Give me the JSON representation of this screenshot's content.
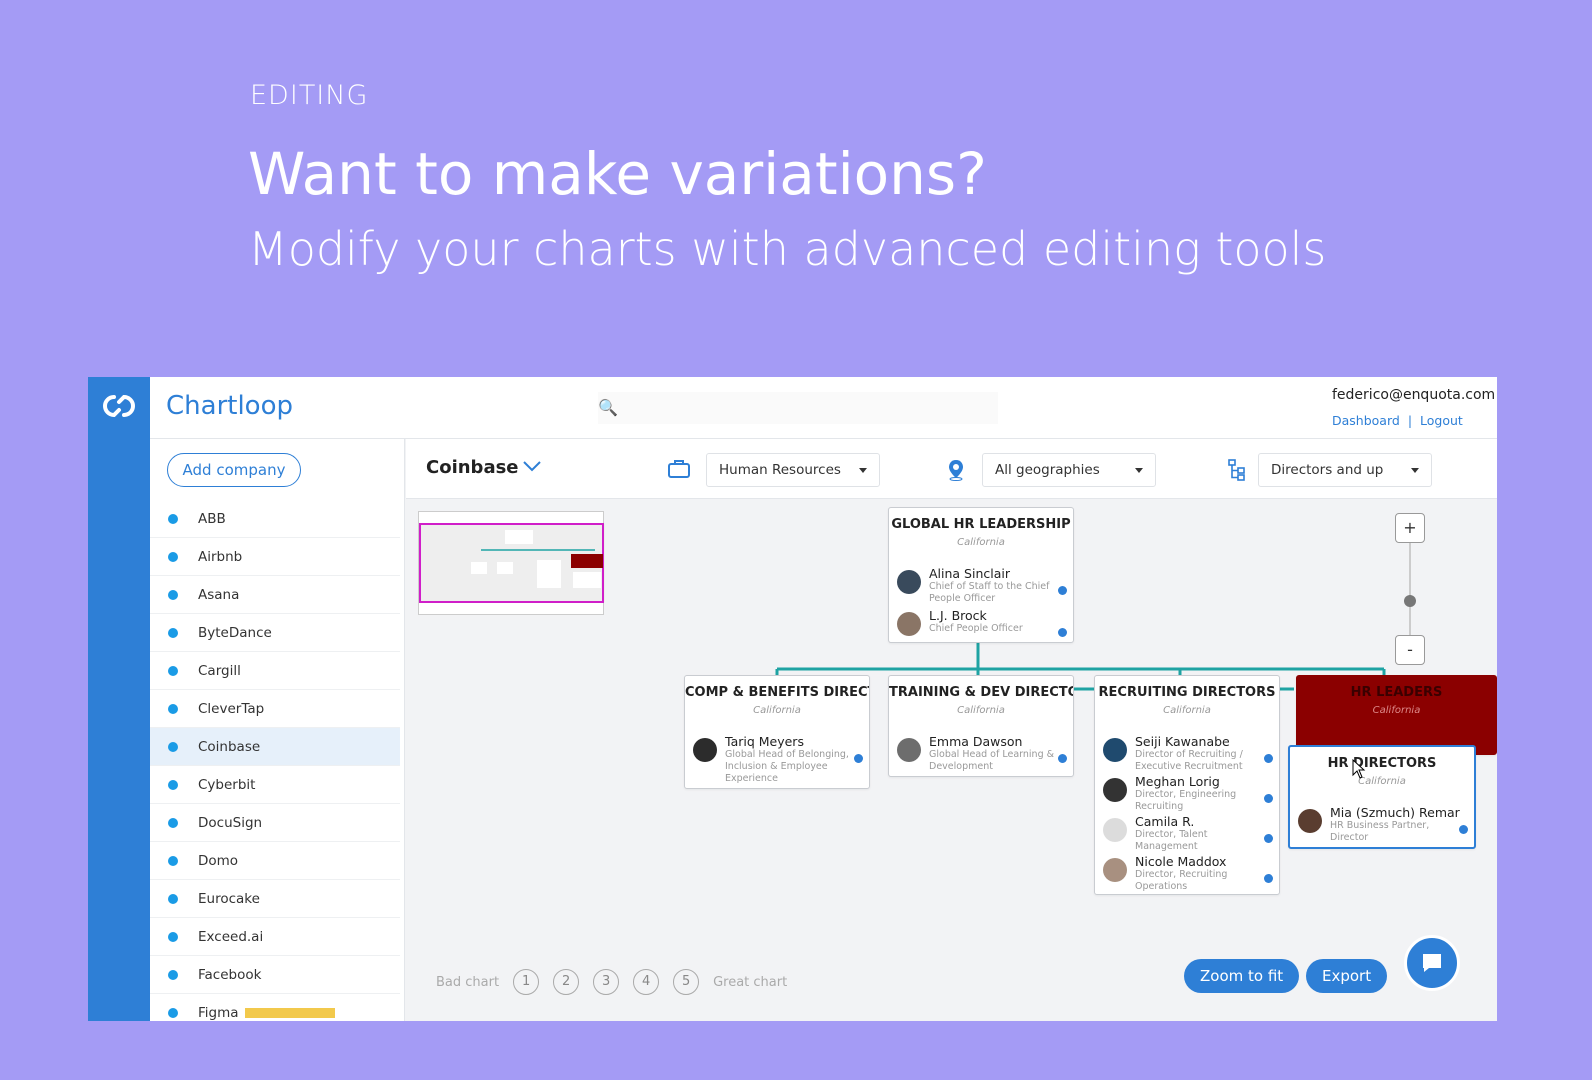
{
  "hero": {
    "eyebrow": "EDITING",
    "title": "Want to make variations?",
    "subtitle": "Modify your charts with advanced editing tools"
  },
  "app": {
    "brand": "Chartloop",
    "search": {
      "placeholder": ""
    },
    "user": {
      "email": "federico@enquota.com",
      "dashboard": "Dashboard",
      "divider": "|",
      "logout": "Logout"
    },
    "sidebar": {
      "add_company": "Add company",
      "companies": [
        "ABB",
        "Airbnb",
        "Asana",
        "ByteDance",
        "Cargill",
        "CleverTap",
        "Coinbase",
        "Cyberbit",
        "DocuSign",
        "Domo",
        "Eurocake",
        "Exceed.ai",
        "Facebook",
        "Figma"
      ],
      "selected": "Coinbase"
    },
    "toolbar": {
      "company": "Coinbase",
      "department": "Human Resources",
      "geography": "All geographies",
      "level": "Directors and up"
    },
    "chart": {
      "root": {
        "title": "GLOBAL HR LEADERSHIP",
        "location": "California",
        "people": [
          {
            "name": "Alina Sinclair",
            "role": "Chief of Staff to the Chief People Officer"
          },
          {
            "name": "L.J. Brock",
            "role": "Chief People Officer"
          }
        ]
      },
      "comp": {
        "title": "COMP & BENEFITS DIRECTOR",
        "location": "California",
        "people": [
          {
            "name": "Tariq Meyers",
            "role": "Global Head of Belonging, Inclusion & Employee Experience"
          }
        ]
      },
      "training": {
        "title": "TRAINING & DEV DIRECTORS",
        "location": "California",
        "people": [
          {
            "name": "Emma Dawson",
            "role": "Global Head of Learning & Development"
          }
        ]
      },
      "recruiting": {
        "title": "RECRUITING DIRECTORS",
        "location": "California",
        "people": [
          {
            "name": "Seiji Kawanabe",
            "role": "Director of Recruiting / Executive Recruitment"
          },
          {
            "name": "Meghan Lorig",
            "role": "Director, Engineering Recruiting"
          },
          {
            "name": "Camila R.",
            "role": "Director, Talent Management"
          },
          {
            "name": "Nicole Maddox",
            "role": "Director, Recruiting Operations"
          }
        ]
      },
      "hr_leaders": {
        "title": "HR LEADERS",
        "location": "California"
      },
      "hr_directors": {
        "title": "HR DIRECTORS",
        "location": "California",
        "people": [
          {
            "name": "Mia (Szmuch) Remar",
            "role": "HR Business Partner, Director"
          }
        ]
      }
    },
    "zoom": {
      "in": "+",
      "out": "-"
    },
    "rating": {
      "low": "Bad chart",
      "high": "Great chart",
      "options": [
        "1",
        "2",
        "3",
        "4",
        "5"
      ]
    },
    "buttons": {
      "zoom_to_fit": "Zoom to fit",
      "export": "Export"
    },
    "colors": {
      "primary": "#2e7fd6",
      "background": "#a49bf5",
      "connector": "#1fa3a3",
      "hr_leaders": "#8b0000"
    }
  }
}
